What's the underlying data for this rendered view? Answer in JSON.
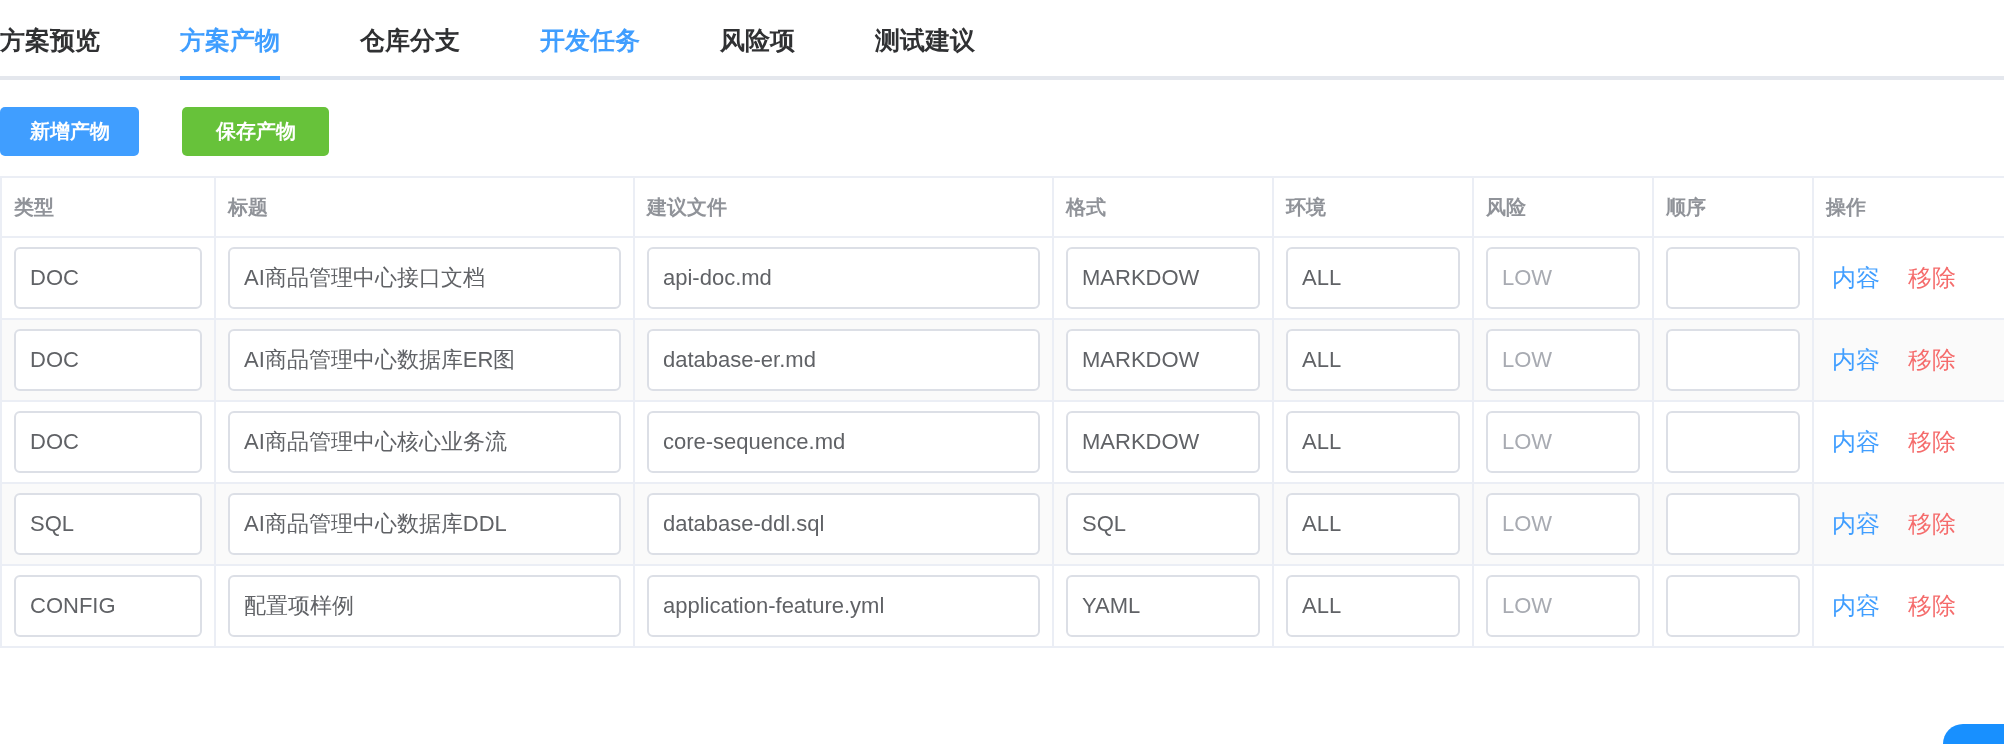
{
  "tabs": [
    {
      "label": "方案预览",
      "selected": false,
      "hovered": false
    },
    {
      "label": "方案产物",
      "selected": true,
      "hovered": false
    },
    {
      "label": "仓库分支",
      "selected": false,
      "hovered": false
    },
    {
      "label": "开发任务",
      "selected": false,
      "hovered": true
    },
    {
      "label": "风险项",
      "selected": false,
      "hovered": false
    },
    {
      "label": "测试建议",
      "selected": false,
      "hovered": false
    }
  ],
  "toolbar": {
    "buttons": [
      {
        "label": "新增产物",
        "kind": "primary"
      },
      {
        "label": "保存产物",
        "kind": "success"
      }
    ]
  },
  "table": {
    "columns": [
      "类型",
      "标题",
      "建议文件",
      "格式",
      "环境",
      "风险",
      "顺序",
      "操作"
    ],
    "rows": [
      {
        "type": "DOC",
        "title": "AI商品管理中心接口文档",
        "file": "api-doc.md",
        "format": "MARKDOW",
        "env": "ALL",
        "risk_placeholder": "LOW",
        "actions": [
          {
            "label": "内容",
            "kind": "link"
          },
          {
            "label": "移除",
            "kind": "danger"
          }
        ]
      },
      {
        "type": "DOC",
        "title": "AI商品管理中心数据库ER图",
        "file": "database-er.md",
        "format": "MARKDOW",
        "env": "ALL",
        "risk_placeholder": "LOW",
        "actions": [
          {
            "label": "内容",
            "kind": "link"
          },
          {
            "label": "移除",
            "kind": "danger"
          }
        ]
      },
      {
        "type": "DOC",
        "title": "AI商品管理中心核心业务流",
        "file": "core-sequence.md",
        "format": "MARKDOW",
        "env": "ALL",
        "risk_placeholder": "LOW",
        "actions": [
          {
            "label": "内容",
            "kind": "link"
          },
          {
            "label": "移除",
            "kind": "danger"
          }
        ]
      },
      {
        "type": "SQL",
        "title": "AI商品管理中心数据库DDL",
        "file": "database-ddl.sql",
        "format": "SQL",
        "env": "ALL",
        "risk_placeholder": "LOW",
        "actions": [
          {
            "label": "内容",
            "kind": "link"
          },
          {
            "label": "移除",
            "kind": "danger"
          }
        ]
      },
      {
        "type": "CONFIG",
        "title": "配置项样例",
        "file": "application-feature.yml",
        "format": "YAML",
        "env": "ALL",
        "risk_placeholder": "LOW",
        "actions": [
          {
            "label": "内容",
            "kind": "link"
          },
          {
            "label": "移除",
            "kind": "danger"
          }
        ]
      }
    ]
  }
}
